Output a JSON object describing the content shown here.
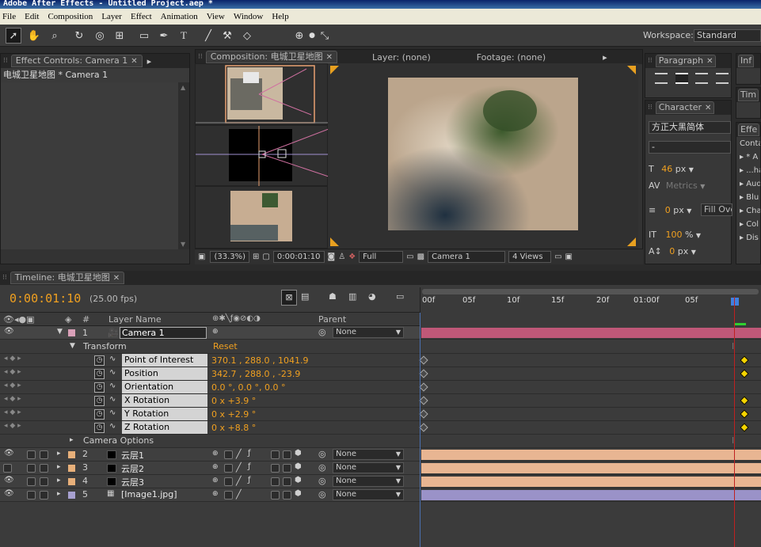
{
  "app": {
    "title": "Adobe After Effects - Untitled Project.aep *"
  },
  "menu": [
    "File",
    "Edit",
    "Composition",
    "Layer",
    "Effect",
    "Animation",
    "View",
    "Window",
    "Help"
  ],
  "toolbar": {
    "tools": [
      "selection-tool",
      "hand-tool",
      "zoom-tool",
      "rotation-tool",
      "orbit-camera-tool",
      "track-xy-camera-tool",
      "rectangle-tool",
      "pen-tool",
      "type-tool",
      "brush-tool",
      "clone-stamp-tool",
      "eraser-tool",
      "local-axis-mode",
      "world-axis-mode",
      "view-axis-mode"
    ],
    "workspace_label": "Workspace:",
    "workspace_value": "Standard"
  },
  "effect_controls": {
    "tab": "Effect Controls: Camera 1",
    "breadcrumb": "电城卫星地图 * Camera 1"
  },
  "composition": {
    "tab": "Composition: 电城卫星地图",
    "layer_tab": "Layer: (none)",
    "footage_tab": "Footage: (none)",
    "zoom": "(33.3%)",
    "timecode": "0:00:01:10",
    "resolution": "Full",
    "camera": "Camera 1",
    "views": "4 Views"
  },
  "paragraph": {
    "tab": "Paragraph"
  },
  "character": {
    "tab": "Character",
    "font": "方正大黑简体",
    "style": "-",
    "size": "46",
    "size_unit": "px",
    "kerning": "Metrics",
    "stroke": "0",
    "stroke_unit": "px",
    "fill_mode": "Fill Over",
    "vscale": "100",
    "vscale_unit": "%",
    "baseline": "0",
    "baseline_unit": "px"
  },
  "side_tabs": {
    "info": "Inf",
    "time": "Tim",
    "effects": "Effe"
  },
  "effects_list": [
    "Conta",
    "* A",
    "...ha",
    "Aud",
    "Blu",
    "Cha",
    "Col",
    "Dis"
  ],
  "timeline": {
    "tab": "Timeline: 电城卫星地图",
    "timecode": "0:00:01:10",
    "fps": "(25.00 fps)",
    "col_layer_name": "Layer Name",
    "col_num": "#",
    "col_parent": "Parent",
    "ruler": [
      "00f",
      "05f",
      "10f",
      "15f",
      "20f",
      "01:00f",
      "05f"
    ],
    "playhead_fraction": 0.9,
    "layers": [
      {
        "num": "1",
        "name": "Camera 1",
        "label_color": "#d9a0b8",
        "parent": "None"
      },
      {
        "num": "2",
        "name": "云层1",
        "label_color": "#e8b07a",
        "parent": "None"
      },
      {
        "num": "3",
        "name": "云层2",
        "label_color": "#e8b07a",
        "parent": "None"
      },
      {
        "num": "4",
        "name": "云层3",
        "label_color": "#e8b07a",
        "parent": "None"
      },
      {
        "num": "5",
        "name": "[Image1.jpg]",
        "label_color": "#a7a0d0",
        "parent": "None"
      }
    ],
    "transform": {
      "label": "Transform",
      "reset": "Reset",
      "properties": [
        {
          "name": "Point of Interest",
          "value": "370.1 , 288.0 , 1041.9",
          "key": true
        },
        {
          "name": "Position",
          "value": "342.7 , 288.0 , -23.9",
          "key": true
        },
        {
          "name": "Orientation",
          "value": "0.0 °, 0.0 °, 0.0 °",
          "key": false
        },
        {
          "name": "X Rotation",
          "value": "0 x +3.9 °",
          "key": true
        },
        {
          "name": "Y Rotation",
          "value": "0 x +2.9 °",
          "key": true
        },
        {
          "name": "Z Rotation",
          "value": "0 x +8.8 °",
          "key": true
        }
      ],
      "camera_options": "Camera Options"
    }
  },
  "colors": {
    "accent": "#f0a020",
    "camera_bar": "#c05878",
    "solid_bar": "#e8b592",
    "image_bar": "#9a92c8",
    "playhead": "#c02020"
  }
}
